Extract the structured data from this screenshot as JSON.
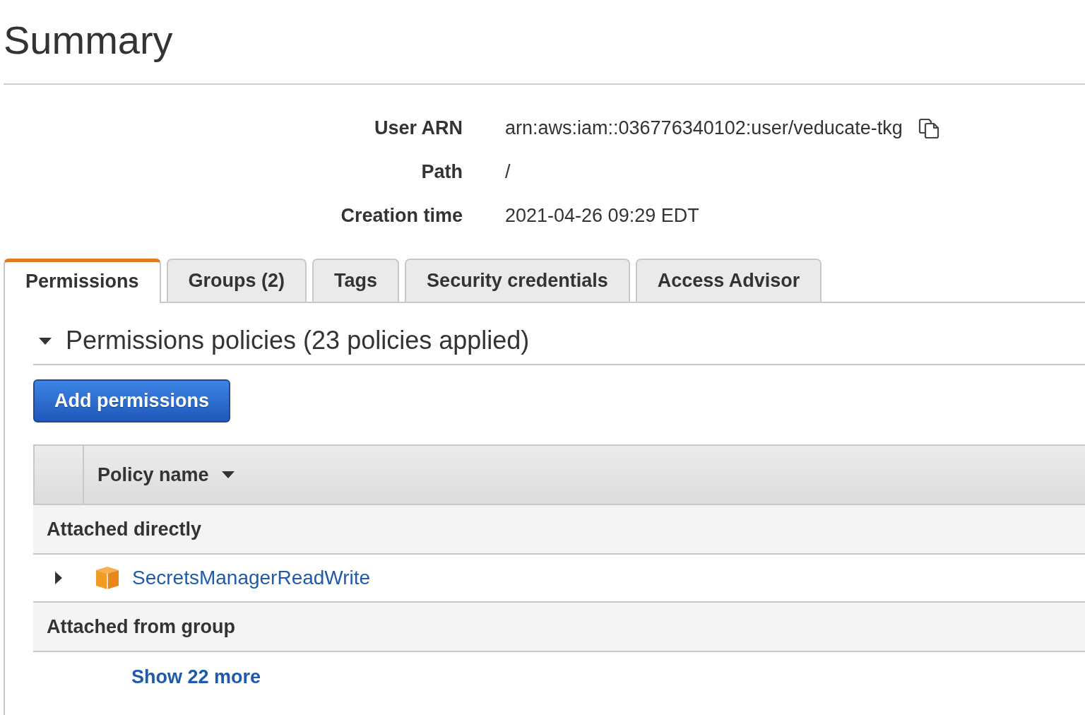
{
  "page": {
    "title": "Summary"
  },
  "summary": [
    {
      "label": "User ARN",
      "value": "arn:aws:iam::036776340102:user/veducate-tkg",
      "copyable": true
    },
    {
      "label": "Path",
      "value": "/"
    },
    {
      "label": "Creation time",
      "value": "2021-04-26 09:29 EDT"
    }
  ],
  "tabs": [
    {
      "label": "Permissions",
      "selected": true
    },
    {
      "label": "Groups (2)",
      "selected": false
    },
    {
      "label": "Tags",
      "selected": false
    },
    {
      "label": "Security credentials",
      "selected": false
    },
    {
      "label": "Access Advisor",
      "selected": false
    }
  ],
  "section": {
    "title": "Permissions policies (23 policies applied)",
    "expanded": true
  },
  "add_button": {
    "label": "Add permissions"
  },
  "table": {
    "columns": [
      {
        "label": "Policy name",
        "sorted": true
      }
    ],
    "rows": [
      {
        "kind": "group",
        "label": "Attached directly"
      },
      {
        "kind": "policy",
        "name": "SecretsManagerReadWrite",
        "expanded": false
      },
      {
        "kind": "group",
        "label": "Attached from group"
      },
      {
        "kind": "more",
        "label": "Show 22 more"
      }
    ]
  }
}
